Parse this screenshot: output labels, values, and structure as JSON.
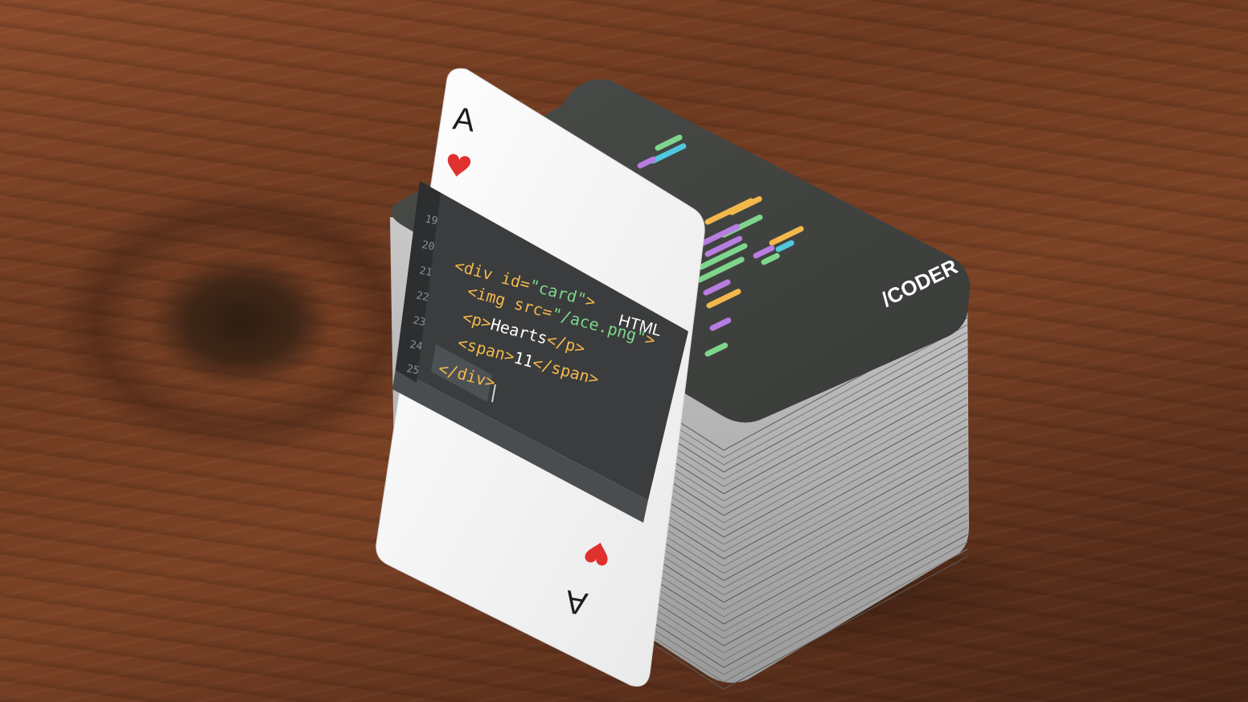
{
  "face_card": {
    "rank_top": "A",
    "rank_bottom": "A",
    "suit_icon": "heart-icon",
    "language_label": "HTML",
    "line_numbers": [
      "19",
      "20",
      "21",
      "22",
      "23",
      "24",
      "25"
    ],
    "code": {
      "line1_tag": "<div id=",
      "line1_value": "\"card\"",
      "line1_close": ">",
      "line2_tag": "<img src=",
      "line2_value": "\"/ace.png\"",
      "line2_close": ">",
      "line3_open": "<p>",
      "line3_text": "Hearts",
      "line3_close": "</p>",
      "line4_open": "<span>",
      "line4_text": "11",
      "line4_close": "</span>",
      "line5": "</div>"
    }
  },
  "deck_back": {
    "brand": "/CODER"
  },
  "colors": {
    "heart": "#e0312f",
    "card_dark": "#3b3d3b",
    "tag": "#f2b84b",
    "attr": "#b77de0",
    "string": "#7fd58b",
    "cyan": "#4fc7dd",
    "text": "#ffffff"
  }
}
